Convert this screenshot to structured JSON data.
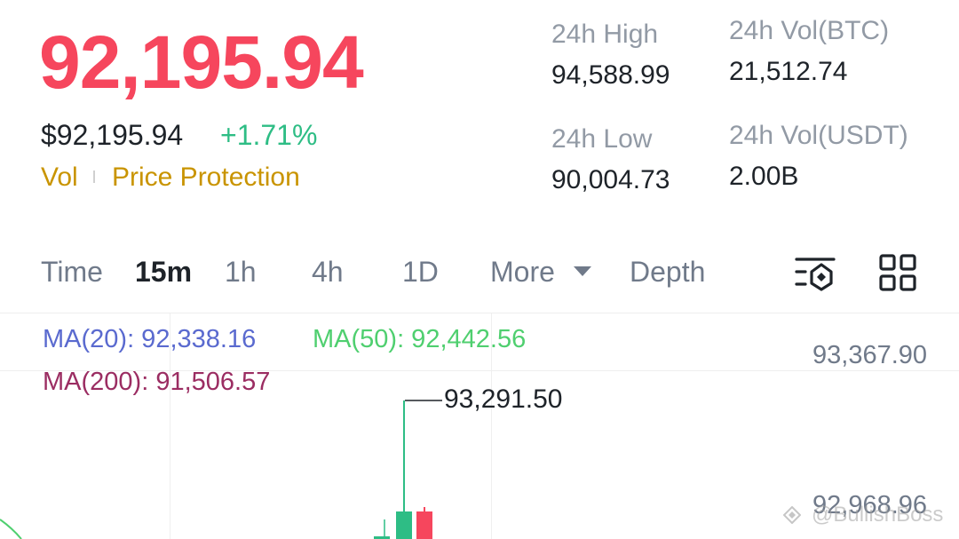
{
  "ticker": {
    "last_price": "92,195.94",
    "usd_price": "$92,195.94",
    "change_pct": "+1.71%",
    "vol_link": "Vol",
    "price_protection_link": "Price Protection"
  },
  "stats": {
    "high_label": "24h High",
    "high_value": "94,588.99",
    "vol_btc_label": "24h Vol(BTC)",
    "vol_btc_value": "21,512.74",
    "low_label": "24h Low",
    "low_value": "90,004.73",
    "vol_usdt_label": "24h Vol(USDT)",
    "vol_usdt_value": "2.00B"
  },
  "tabs": {
    "time": "Time",
    "m15": "15m",
    "h1": "1h",
    "h4": "4h",
    "d1": "1D",
    "more": "More",
    "depth": "Depth",
    "active": "15m"
  },
  "icons": {
    "chart_settings": "chart-settings-icon",
    "layout_grid": "layout-grid-icon"
  },
  "indicators": {
    "ma20": "MA(20): 92,338.16",
    "ma50": "MA(50): 92,442.56",
    "ma200": "MA(200): 91,506.57"
  },
  "chart": {
    "axis_top": "93,367.90",
    "axis_mid": "92,968.96",
    "high_marker": "93,291.50"
  },
  "watermark": "@BullishBoss",
  "colors": {
    "up": "#2ebd85",
    "down": "#f6465d",
    "accent": "#c99400"
  }
}
